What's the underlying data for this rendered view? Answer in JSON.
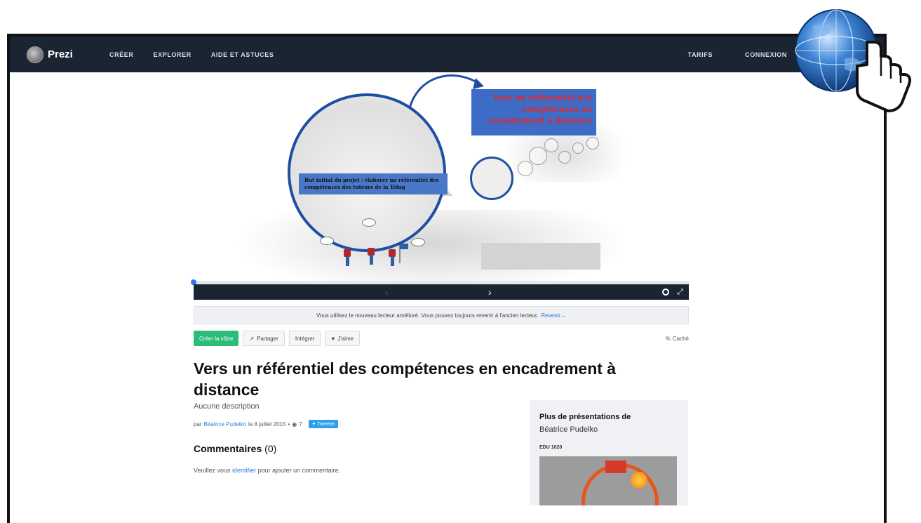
{
  "nav": {
    "brand": "Prezi",
    "links": [
      "CRÉER",
      "EXPLORER",
      "AIDE ET ASTUCES"
    ],
    "right_links": [
      "TARIFS",
      "CONNEXION"
    ]
  },
  "presentation": {
    "title_slide": "Vers un référentiel des compétences en encadrement à distance",
    "circle_text": "But initial du projet : élaborer un référentiel des compétences des tuteurs de la Téluq",
    "progress": 0.0
  },
  "notice": {
    "text": "Vous utilisez le nouveau lecteur amélioré. Vous pouvez toujours revenir à l'ancien lecteur.",
    "link": "Revenir→"
  },
  "actions": {
    "create": "Créer la vôtre",
    "share": "Partager",
    "embed": "Intégrer",
    "like": "J'aime",
    "hidden": "Caché"
  },
  "page": {
    "title": "Vers un référentiel des compétences en encadrement à distance",
    "description": "Aucune description",
    "by": "par",
    "author": "Béatrice Pudelko",
    "date": "le 8 juillet 2015",
    "views": "7",
    "tweet": "Tweeter"
  },
  "comments": {
    "heading": "Commentaires",
    "count": "(0)",
    "prompt_before": "Veuillez vous",
    "prompt_link": "identifier",
    "prompt_after": "pour ajouter un commentaire."
  },
  "sidebar": {
    "heading": "Plus de présentations de",
    "author": "Béatrice Pudelko",
    "item_title": "EDU 1020"
  },
  "colors": {
    "navbar": "#1b2433",
    "accent_blue": "#2f7ae0",
    "create_green": "#2bbd77",
    "slide_title_red": "#e4262c",
    "circle_blue": "#1f4fa3"
  },
  "icons": {
    "share": "external-share-icon",
    "like": "heart-icon",
    "hidden": "link-icon",
    "settings": "gear-icon",
    "fullscreen": "expand-icon",
    "views": "eye-icon",
    "tweet": "twitter-bird-icon",
    "overlay": "globe-hand-cursor-icon"
  }
}
